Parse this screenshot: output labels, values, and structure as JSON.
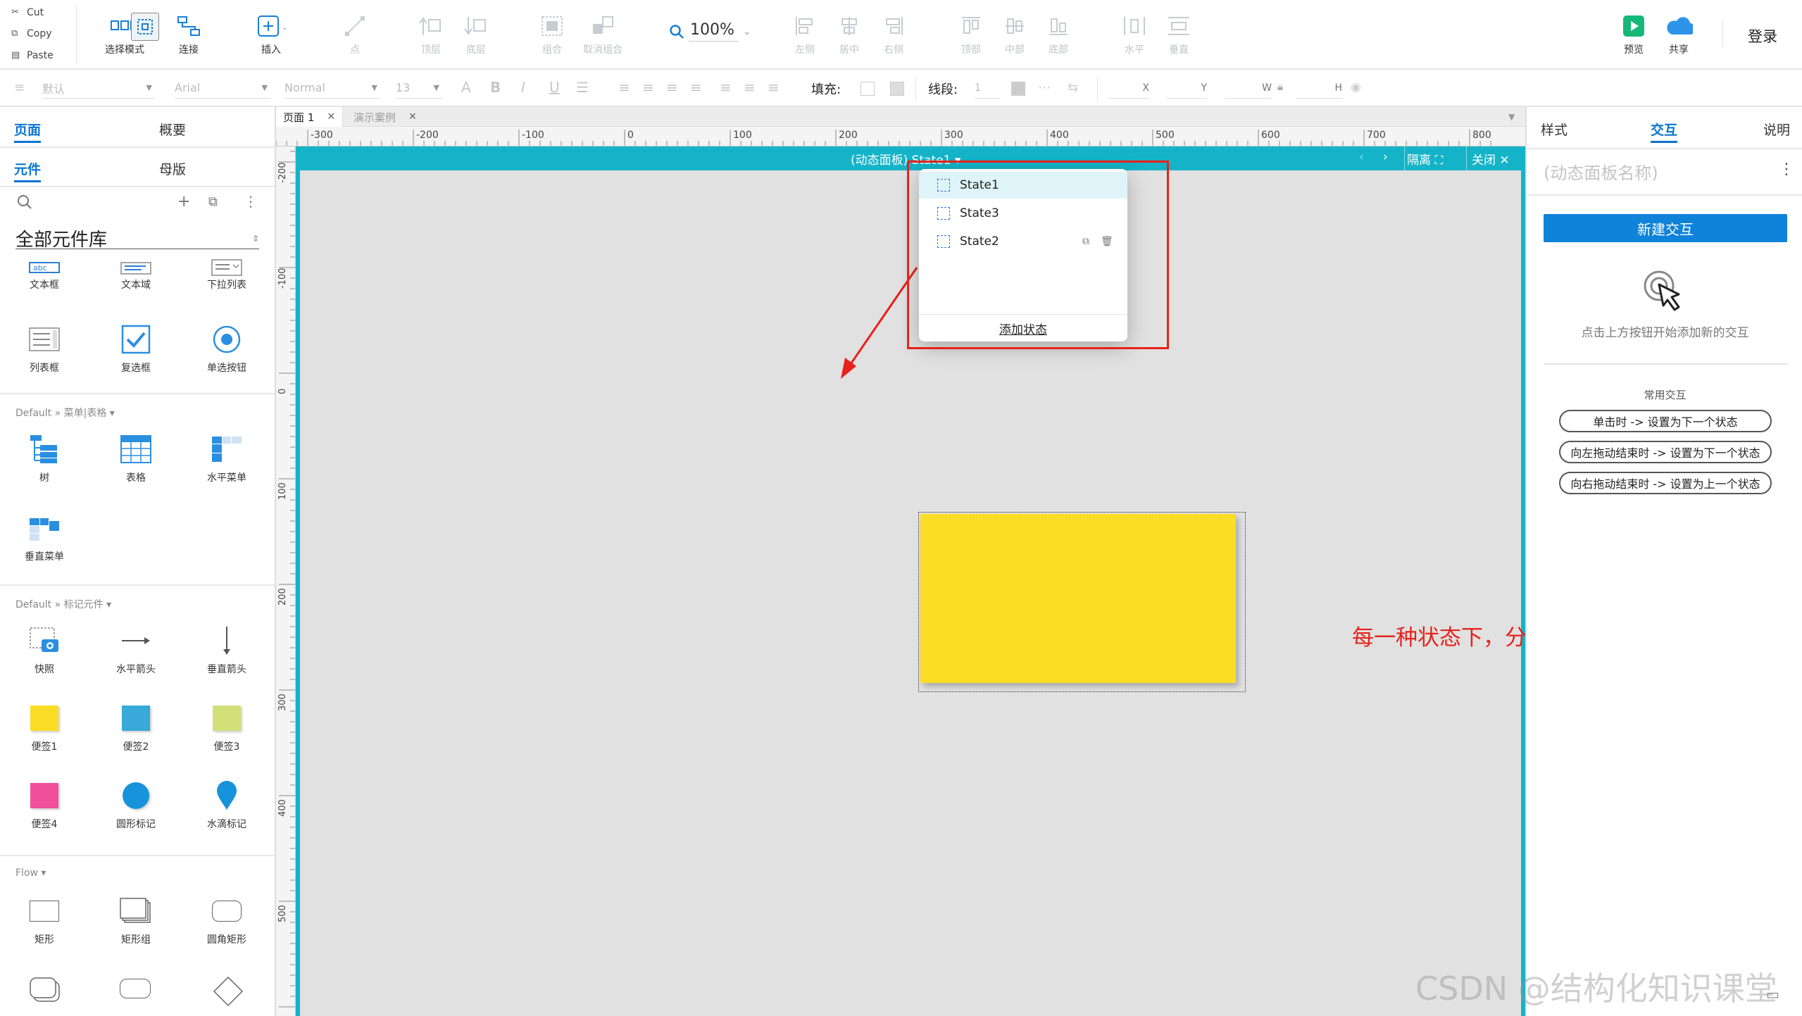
{
  "clipboard": {
    "cut": "Cut",
    "copy": "Copy",
    "paste": "Paste"
  },
  "toolbar": {
    "select_mode": "选择模式",
    "connect": "连接",
    "insert": "插入",
    "point": "点",
    "top_layer": "顶层",
    "bottom_layer": "底层",
    "group": "组合",
    "ungroup": "取消组合",
    "zoom": "100%",
    "align_left": "左侧",
    "align_center": "居中",
    "align_right": "右侧",
    "align_top": "顶部",
    "align_middle": "中部",
    "align_bottom": "底部",
    "dist_h": "水平",
    "dist_v": "垂直",
    "preview": "预览",
    "share": "共享",
    "login": "登录"
  },
  "format_bar": {
    "style": "默认",
    "font": "Arial",
    "weight": "Normal",
    "size": "13",
    "fill_label": "填充:",
    "line_label": "线段:",
    "line_value": "1",
    "x": "X",
    "y": "Y",
    "w": "W",
    "h": "H"
  },
  "left": {
    "tab_pages": "页面",
    "tab_outline": "概要",
    "tab_widgets": "元件",
    "tab_masters": "母版",
    "library": "全部元件库",
    "row0": [
      "文本框",
      "文本域",
      "下拉列表"
    ],
    "row1": [
      "列表框",
      "复选框",
      "单选按钮"
    ],
    "group_menu": "Default » 菜单|表格 ▾",
    "row2": [
      "树",
      "表格",
      "水平菜单"
    ],
    "row3": [
      "垂直菜单"
    ],
    "group_markup": "Default » 标记元件 ▾",
    "row4": [
      "快照",
      "水平箭头",
      "垂直箭头"
    ],
    "row5": [
      "便签1",
      "便签2",
      "便签3"
    ],
    "row6": [
      "便签4",
      "圆形标记",
      "水滴标记"
    ],
    "group_flow": "Flow ▾",
    "row7": [
      "矩形",
      "矩形组",
      "圆角矩形"
    ]
  },
  "page_tabs": [
    "页面 1",
    "演示案例"
  ],
  "ruler_h": [
    "-300",
    "-200",
    "-100",
    "0",
    "100",
    "200",
    "300",
    "400",
    "500",
    "600",
    "700",
    "800"
  ],
  "ruler_v": [
    "-200",
    "-100",
    "0",
    "100",
    "200",
    "300",
    "400",
    "500"
  ],
  "panel_bar": {
    "title": "(动态面板)  State1 ▾",
    "isolate": "隔离",
    "close": "关闭"
  },
  "states": {
    "items": [
      "State1",
      "State3",
      "State2"
    ],
    "add": "添加状态"
  },
  "annotation": "每一种状态下，分别拖入一个便签",
  "right": {
    "tab_style": "样式",
    "tab_interact": "交互",
    "tab_notes": "说明",
    "name_placeholder": "(动态面板名称)",
    "new_interaction": "新建交互",
    "hint": "点击上方按钮开始添加新的交互",
    "common": "常用交互",
    "pills": [
      "单击时 -> 设置为下一个状态",
      "向左拖动结束时 -> 设置为下一个状态",
      "向右拖动结束时 -> 设置为上一个状态"
    ]
  },
  "watermark": "CSDN @结构化知识课堂",
  "colors": {
    "accent": "#0f82d9",
    "teal": "#14b3c8",
    "sticky": "#fcdd25",
    "annotation": "#e8221b"
  }
}
